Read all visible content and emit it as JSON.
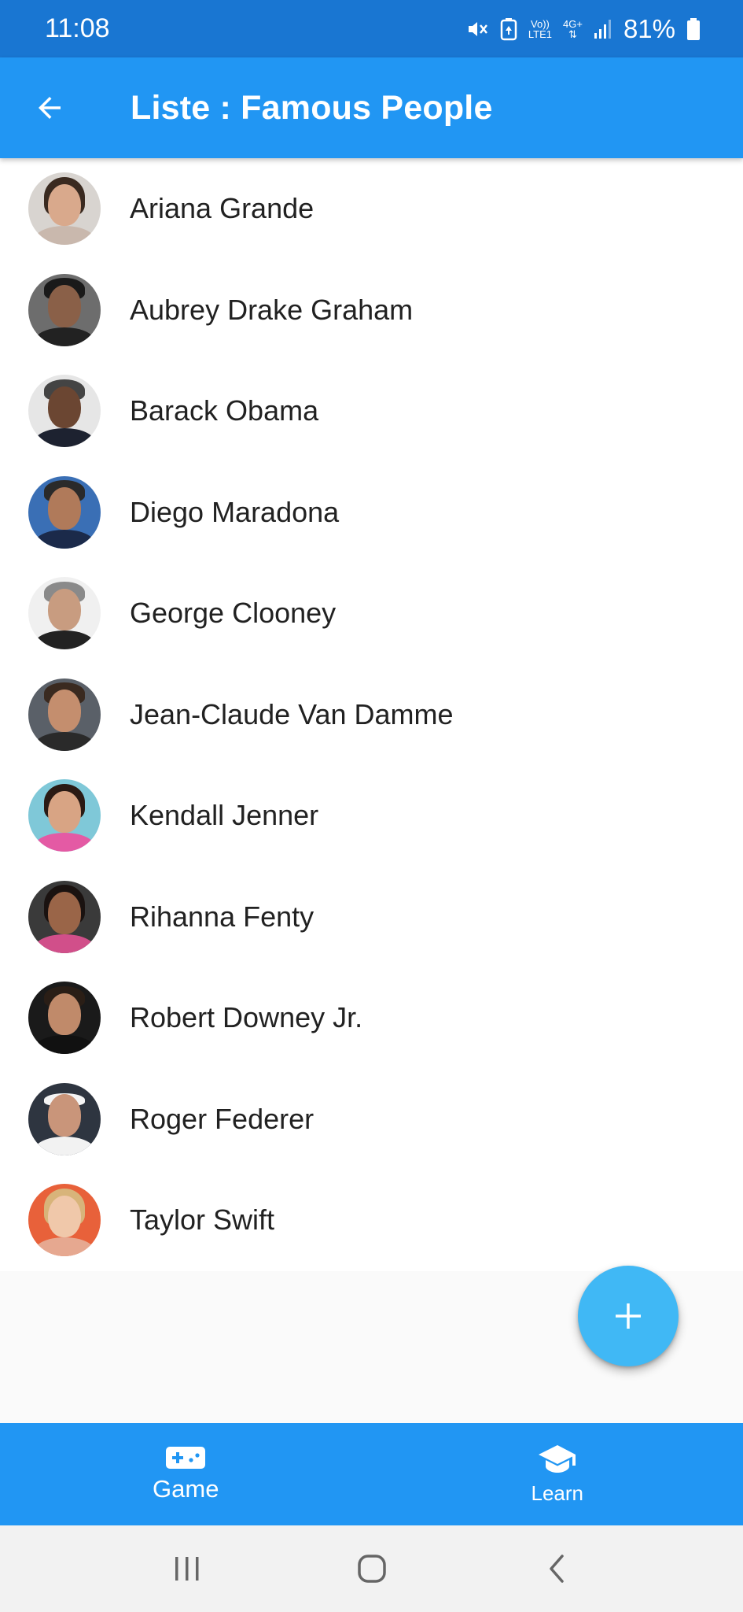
{
  "status_bar": {
    "time": "11:08",
    "battery_percent": "81%",
    "network_label_top": "Vo))",
    "network_label_bottom": "LTE1",
    "network_type": "4G+"
  },
  "app_bar": {
    "title": "Liste : Famous People"
  },
  "people": [
    {
      "name": "Ariana Grande"
    },
    {
      "name": "Aubrey Drake Graham"
    },
    {
      "name": "Barack Obama"
    },
    {
      "name": "Diego Maradona"
    },
    {
      "name": "George Clooney"
    },
    {
      "name": "Jean-Claude Van Damme"
    },
    {
      "name": "Kendall Jenner"
    },
    {
      "name": "Rihanna Fenty"
    },
    {
      "name": "Robert Downey Jr."
    },
    {
      "name": "Roger Federer"
    },
    {
      "name": "Taylor Swift"
    }
  ],
  "bottom_nav": {
    "items": [
      {
        "label": "Game",
        "icon": "gamepad-icon"
      },
      {
        "label": "Learn",
        "icon": "school-icon"
      }
    ]
  },
  "colors": {
    "status_bar": "#1976d2",
    "app_bar": "#2196f3",
    "fab": "#40b8f5",
    "bottom_nav": "#2196f3"
  }
}
